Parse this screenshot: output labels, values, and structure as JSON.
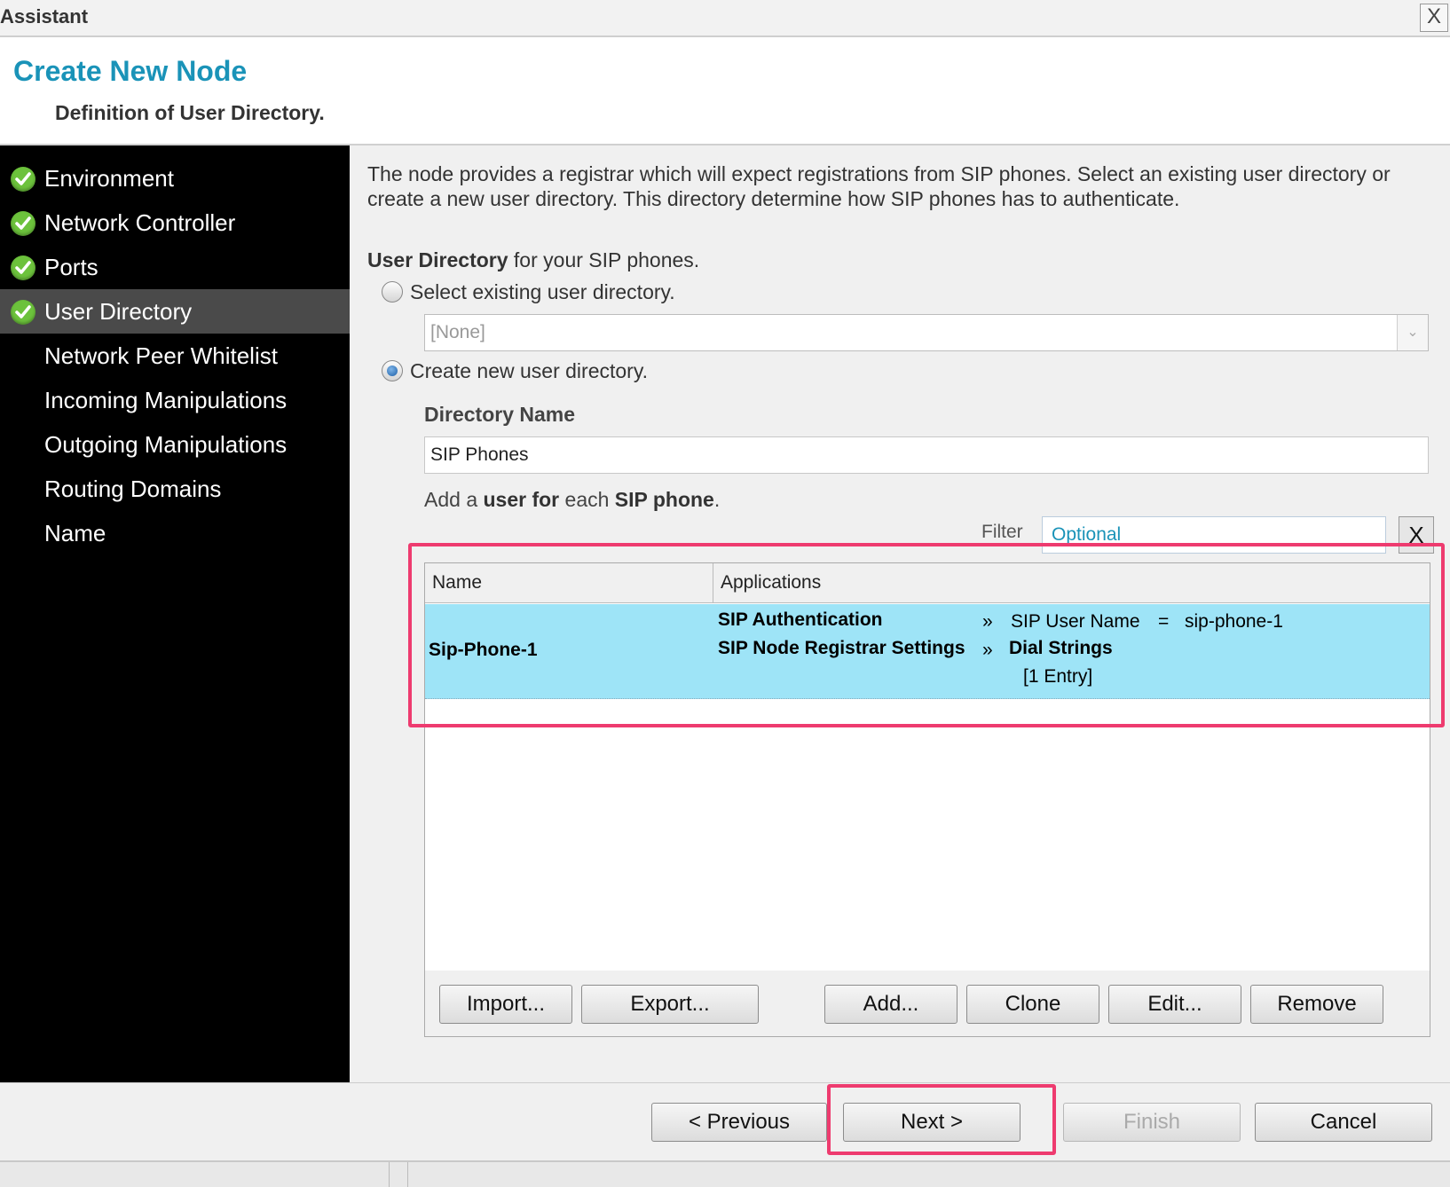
{
  "window": {
    "title": "Assistant",
    "close_label": "X"
  },
  "header": {
    "title": "Create New Node",
    "subtitle": "Definition of User Directory."
  },
  "sidebar": {
    "items": [
      {
        "label": "Environment",
        "done": true
      },
      {
        "label": "Network Controller",
        "done": true
      },
      {
        "label": "Ports",
        "done": true
      },
      {
        "label": "User Directory",
        "done": true,
        "active": true
      },
      {
        "label": "Network Peer Whitelist",
        "done": false
      },
      {
        "label": "Incoming Manipulations",
        "done": false
      },
      {
        "label": "Outgoing Manipulations",
        "done": false
      },
      {
        "label": "Routing Domains",
        "done": false
      },
      {
        "label": "Name",
        "done": false
      }
    ]
  },
  "main": {
    "description": "The node provides a registrar which will expect registrations from SIP phones. Select an existing user directory or create a new user directory. This directory determine how SIP phones has to authenticate.",
    "user_directory_bold": "User Directory",
    "user_directory_rest": " for your SIP phones.",
    "option_existing": "Select existing user directory.",
    "existing_combo_value": "[None]",
    "option_new": "Create new user directory.",
    "directory_name_label": "Directory Name",
    "directory_name_value": "SIP Phones",
    "hint_parts": [
      "Add a ",
      "user for",
      " each ",
      "SIP phone",
      "."
    ],
    "filter_label": "Filter",
    "filter_placeholder": "Optional",
    "filter_clear": "X",
    "table": {
      "columns": [
        "Name",
        "Applications"
      ],
      "rows": [
        {
          "name": "Sip-Phone-1",
          "app1": "SIP Authentication",
          "app1_arrow": "»",
          "app1_key": "SIP User Name",
          "app1_eq": "=",
          "app1_value": "sip-phone-1",
          "app2": "SIP Node Registrar Settings",
          "app2_arrow": "»",
          "app2_key": "Dial Strings",
          "app2_value": "[1 Entry]"
        }
      ]
    },
    "buttons": {
      "import": "Import...",
      "export": "Export...",
      "add": "Add...",
      "clone": "Clone",
      "edit": "Edit...",
      "remove": "Remove"
    }
  },
  "footer": {
    "previous": "< Previous",
    "next": "Next >",
    "finish": "Finish",
    "cancel": "Cancel"
  },
  "colors": {
    "accent": "#1a93b8",
    "selected_row": "#9ee4f7",
    "highlight": "#ee3b6f",
    "check": "#6cc23c"
  }
}
